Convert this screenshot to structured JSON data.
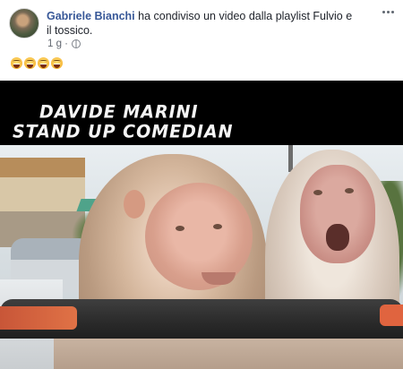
{
  "post": {
    "author": "Gabriele Bianchi",
    "action_text": " ha condiviso un video dalla playlist Fulvio e il tossico.",
    "timestamp": "1 g ·",
    "privacy_icon": "globe-icon",
    "more_icon": "more-options-icon",
    "reaction_emojis": [
      "laugh-cry-emoji",
      "laugh-cry-emoji",
      "laugh-cry-emoji",
      "laugh-cry-emoji"
    ]
  },
  "video": {
    "caption_line1": "DAVIDE MARINI",
    "caption_line2": "STAND UP COMEDIAN"
  }
}
